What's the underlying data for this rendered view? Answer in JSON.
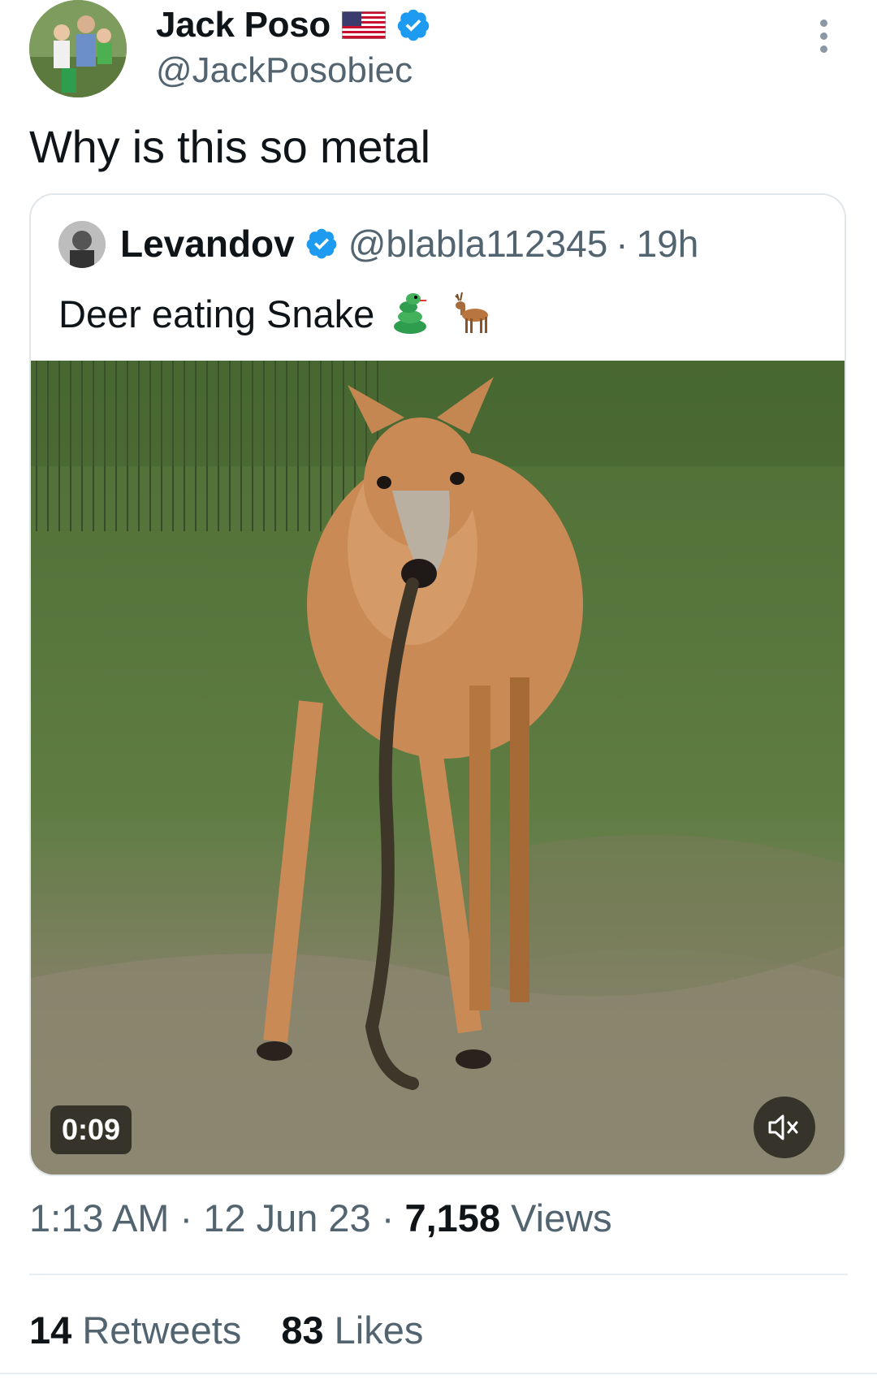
{
  "tweet": {
    "author": {
      "name": "Jack Poso",
      "handle": "@JackPosobiec",
      "flag_icon": "us-flag-icon",
      "verified_icon": "verified-badge-icon"
    },
    "text": "Why is this so metal",
    "quoted": {
      "name": "Levandov",
      "handle": "@blabla112345",
      "separator": "·",
      "time": "19h",
      "text": "Deer eating Snake",
      "emojis": [
        "snake-emoji",
        "deer-emoji"
      ],
      "video": {
        "duration": "0:09",
        "mute_icon": "speaker-muted-icon"
      }
    },
    "meta": {
      "time": "1:13 AM",
      "sep1": "·",
      "date": "12 Jun 23",
      "sep2": "·",
      "views_count": "7,158",
      "views_label": "Views"
    },
    "stats": {
      "retweets_count": "14",
      "retweets_label": "Retweets",
      "likes_count": "83",
      "likes_label": "Likes"
    }
  },
  "colors": {
    "text_primary": "#0f1419",
    "text_secondary": "#536471",
    "verified_blue": "#1d9bf0",
    "border": "#e1e6ea"
  }
}
